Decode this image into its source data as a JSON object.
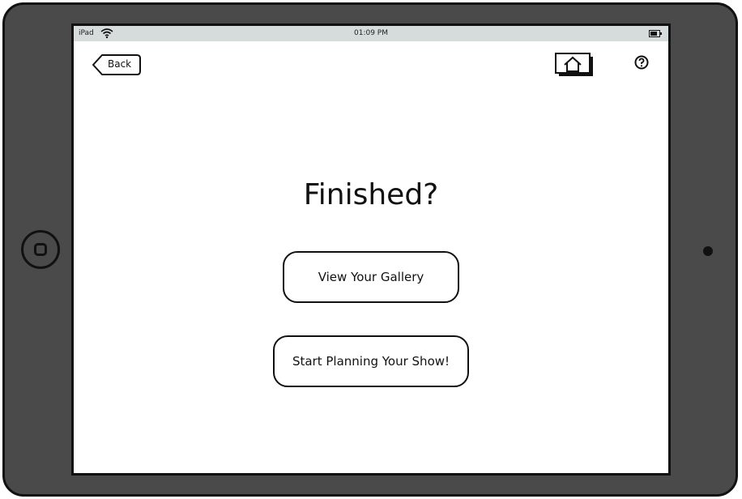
{
  "status_bar": {
    "carrier": "iPad",
    "time": "01:09 PM"
  },
  "nav": {
    "back_label": "Back",
    "home_icon": "home-icon",
    "help_icon": "help-icon"
  },
  "main": {
    "title": "Finished?",
    "buttons": [
      {
        "label": "View Your Gallery"
      },
      {
        "label": "Start Planning Your Show!"
      }
    ]
  },
  "colors": {
    "bezel": "#4a4a4a",
    "status_bar": "#d6dcdc",
    "ink": "#111111"
  }
}
